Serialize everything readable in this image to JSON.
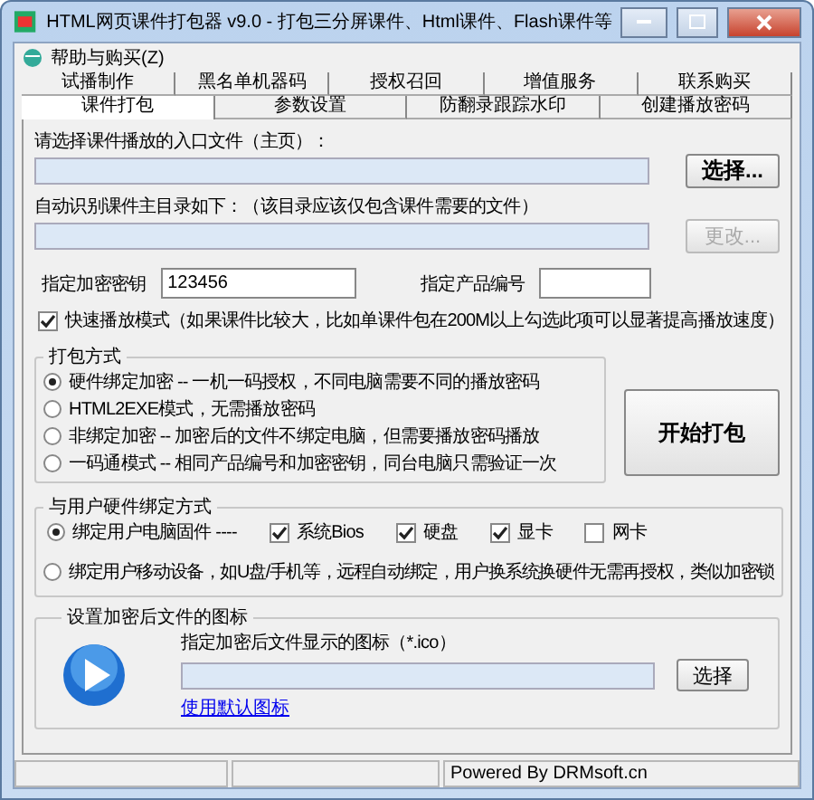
{
  "window": {
    "title": "HTML网页课件打包器 v9.0 - 打包三分屏课件、Html课件、Flash课件等"
  },
  "menu": [
    {
      "label": "帮助与购买(Z)"
    }
  ],
  "tab_rows": [
    [
      {
        "label": "试播制作",
        "selected": false
      },
      {
        "label": "黑名单机器码",
        "selected": false
      },
      {
        "label": "授权召回",
        "selected": false
      },
      {
        "label": "增值服务",
        "selected": false
      },
      {
        "label": "联系购买",
        "selected": false
      }
    ],
    [
      {
        "label": "课件打包",
        "selected": true
      },
      {
        "label": "参数设置",
        "selected": false
      },
      {
        "label": "防翻录跟踪水印",
        "selected": false
      },
      {
        "label": "创建播放密码",
        "selected": false
      }
    ]
  ],
  "entry_file": {
    "label": "请选择课件播放的入口文件（主页）：",
    "button": "选择...",
    "disabled": false
  },
  "main_dir": {
    "label": "自动识别课件主目录如下：（该目录应该仅包含课件需要的文件）",
    "button": "更改...",
    "disabled": true
  },
  "key": {
    "label": "指定加密密钥",
    "value": "123456"
  },
  "product": {
    "label": "指定产品编号"
  },
  "fast_mode": {
    "label": "快速播放模式（如果课件比较大，比如单课件包在200M以上勾选此项可以显著提高播放速度）",
    "checked": true
  },
  "pack_mode": {
    "title": "打包方式",
    "options": [
      {
        "label": "硬件绑定加密 -- 一机一码授权，不同电脑需要不同的播放密码",
        "selected": true
      },
      {
        "label": "HTML2EXE模式，无需播放密码",
        "selected": false
      },
      {
        "label": "非绑定加密 -- 加密后的文件不绑定电脑，但需要播放密码播放",
        "selected": false
      },
      {
        "label": "一码通模式 -- 相同产品编号和加密密钥，同台电脑只需验证一次",
        "selected": false
      }
    ]
  },
  "start_button": "开始打包",
  "binding": {
    "title": "与用户硬件绑定方式",
    "firmware": {
      "label": "绑定用户电脑固件 ----",
      "selected": true
    },
    "parts": [
      {
        "label": "系统Bios",
        "checked": true
      },
      {
        "label": "硬盘",
        "checked": true
      },
      {
        "label": "显卡",
        "checked": true
      },
      {
        "label": "网卡",
        "checked": false
      }
    ],
    "mobile": {
      "label": "绑定用户移动设备，如U盘/手机等，远程自动绑定，用户换系统换硬件无需再授权，类似加密锁",
      "selected": false
    }
  },
  "icon_group": {
    "title": "设置加密后文件的图标",
    "label": "指定加密后文件显示的图标（*.ico）",
    "button": "选择",
    "link": "使用默认图标"
  },
  "status_bar": {
    "text": "Powered By DRMsoft.cn"
  }
}
